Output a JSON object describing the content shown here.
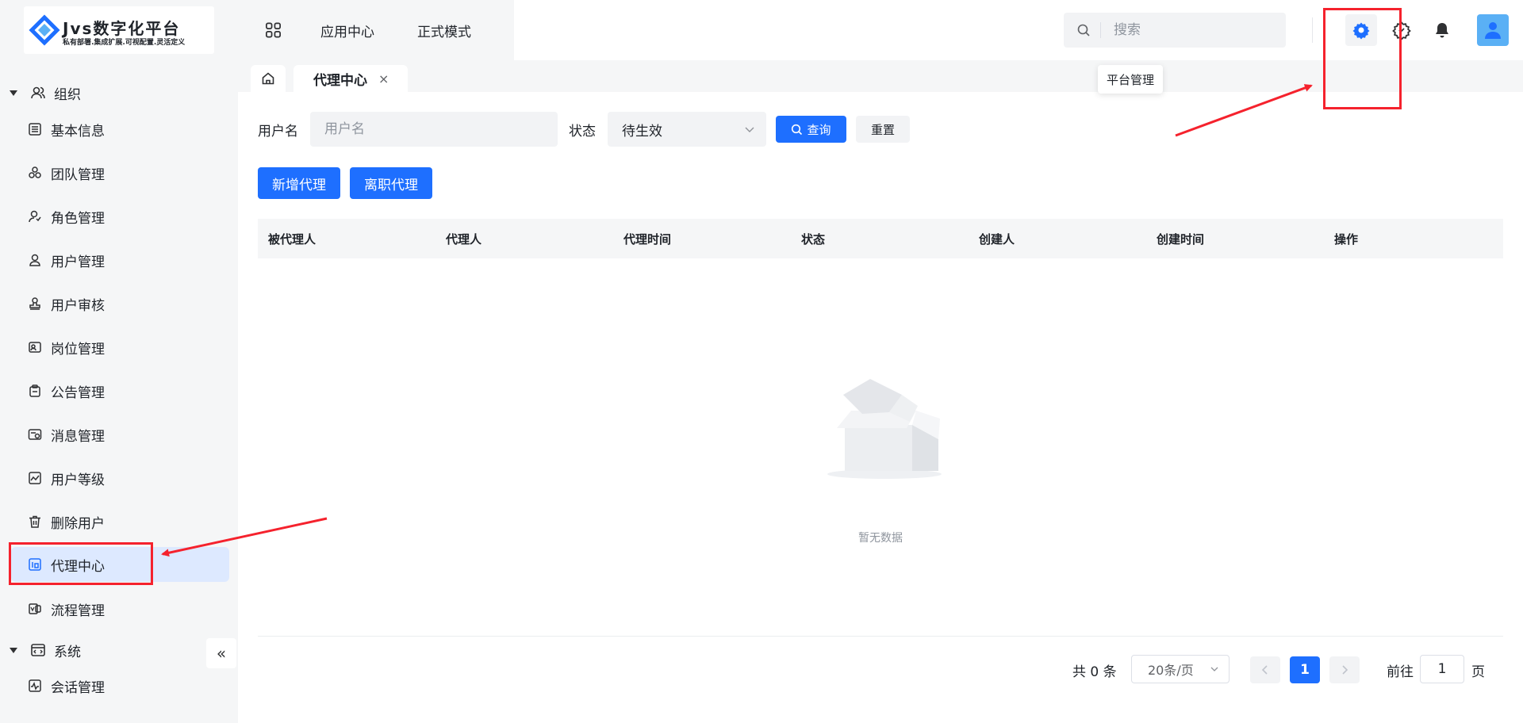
{
  "brand": {
    "title": "Jvs数字化平台",
    "subtitle": "私有部署.集成扩展.可视配置.灵活定义"
  },
  "colors": {
    "primary": "#1e6fff",
    "annotation": "#f5222d",
    "active_bg": "#dde9ff"
  },
  "topnav": {
    "apps_icon": "grid-icon",
    "links": [
      "应用中心",
      "正式模式"
    ],
    "search_placeholder": "搜索",
    "tooltip": "平台管理"
  },
  "sidebar": {
    "groups": [
      {
        "label": "组织",
        "icon": "users-icon"
      },
      {
        "label": "系统",
        "icon": "code-window-icon"
      }
    ],
    "items": [
      {
        "label": "基本信息",
        "icon": "list-icon"
      },
      {
        "label": "团队管理",
        "icon": "team-icon"
      },
      {
        "label": "角色管理",
        "icon": "role-icon"
      },
      {
        "label": "用户管理",
        "icon": "user-icon"
      },
      {
        "label": "用户审核",
        "icon": "stamp-icon"
      },
      {
        "label": "岗位管理",
        "icon": "id-card-icon"
      },
      {
        "label": "公告管理",
        "icon": "clipboard-icon"
      },
      {
        "label": "消息管理",
        "icon": "message-icon"
      },
      {
        "label": "用户等级",
        "icon": "chart-icon"
      },
      {
        "label": "删除用户",
        "icon": "trash-icon"
      },
      {
        "label": "代理中心",
        "icon": "agent-icon",
        "active": true
      },
      {
        "label": "流程管理",
        "icon": "flow-icon"
      },
      {
        "label": "会话管理",
        "icon": "session-icon"
      }
    ],
    "collapse": "«"
  },
  "tabs": {
    "active": "代理中心",
    "close": "×"
  },
  "filters": {
    "username_label": "用户名",
    "username_placeholder": "用户名",
    "status_label": "状态",
    "status_value": "待生效",
    "query": "查询",
    "reset": "重置"
  },
  "actions": {
    "add": "新增代理",
    "resign": "离职代理"
  },
  "table": {
    "columns": [
      "被代理人",
      "代理人",
      "代理时间",
      "状态",
      "创建人",
      "创建时间",
      "操作"
    ],
    "rows": [],
    "empty_text": "暂无数据"
  },
  "pagination": {
    "total": "共 0 条",
    "page_size": "20条/页",
    "current_page": "1",
    "goto_label": "前往",
    "goto_value": "1",
    "goto_unit": "页"
  }
}
